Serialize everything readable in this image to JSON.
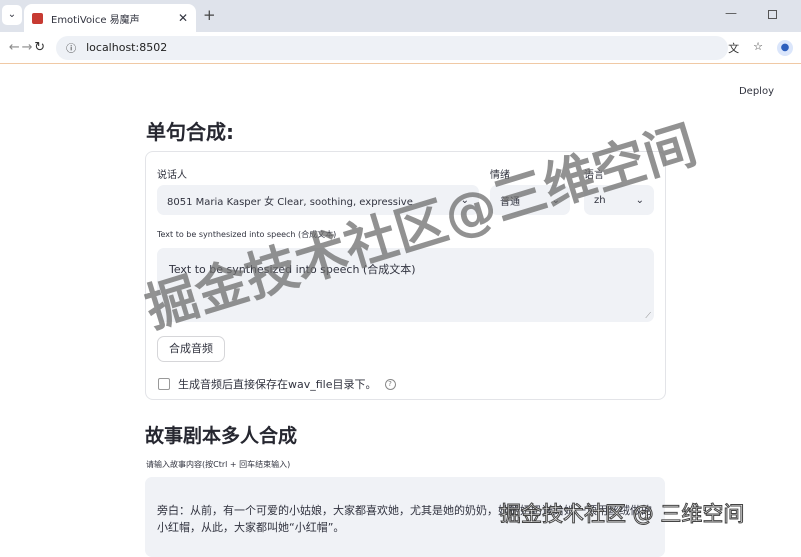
{
  "browser": {
    "tab_title": "EmotiVoice 易魔声",
    "url": "localhost:8502"
  },
  "header": {
    "deploy": "Deploy"
  },
  "single": {
    "title": "单句合成:",
    "speaker_label": "说话人",
    "speaker_value": "8051 Maria Kasper 女 Clear, soothing, expressive",
    "emotion_label": "情绪",
    "emotion_value": "普通",
    "lang_label": "语言",
    "lang_value": "zh",
    "text_label": "Text to be synthesized into speech (合成文本)",
    "text_value": "Text to be synthesized into speech (合成文本)",
    "button": "合成音频",
    "checkbox_label": "生成音频后直接保存在wav_file目录下。"
  },
  "story": {
    "title": "故事剧本多人合成",
    "label": "请输入故事内容(按Ctrl + 回车结束输入)",
    "value": "旁白：从前，有一个可爱的小姑娘，大家都喜欢她，尤其是她的奶奶，她的奶奶送给她一顶用丝绒做的小红帽，从此，大家都叫她“小红帽”。"
  },
  "watermark": {
    "large": "掘金技术社区@三维空间",
    "small": "掘金技术社区 @ 三维空间"
  }
}
